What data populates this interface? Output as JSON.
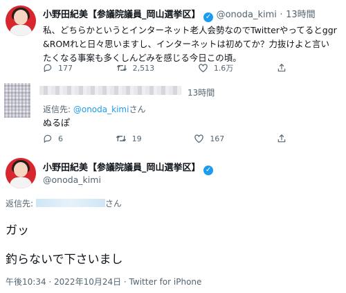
{
  "tweet1": {
    "display_name": "小野田紀美【参議院議員_岡山選挙区】",
    "handle": "@onoda_kimi",
    "dot": "·",
    "time": "13時間",
    "body_lines": [
      "私、どちらかというとインターネット老人会勢なのでTwitterやってるとggr",
      "&ROMれと日々思いますし、インターネットは初めてか？力抜けよと言い",
      "たくなる事案も多くしんどみを感じる今日この頃。"
    ],
    "replies": "177",
    "retweets": "2,513",
    "likes": "1.6万"
  },
  "tweet2": {
    "time": "13時間",
    "reply_prefix": "返信先: ",
    "reply_to": "@onoda_kimi",
    "reply_suffix": "さん",
    "body": "ぬるぽ",
    "replies": "6",
    "retweets": "19",
    "likes": "167"
  },
  "main": {
    "display_name": "小野田紀美【参議院議員_岡山選挙区】",
    "handle": "@onoda_kimi",
    "reply_prefix": "返信先: ",
    "reply_suffix": "さん",
    "line1": "ガッ",
    "line2": "釣らないで下さいまし",
    "timestamp": "午後10:34 · 2022年10月24日 · Twitter for iPhone"
  },
  "colors": {
    "accent": "#1d9bf0",
    "secondary_text": "#536471",
    "avatar_bg": "#d8262f"
  },
  "icons": [
    "verified-badge-icon",
    "reply-icon",
    "retweet-icon",
    "like-icon",
    "share-icon"
  ]
}
